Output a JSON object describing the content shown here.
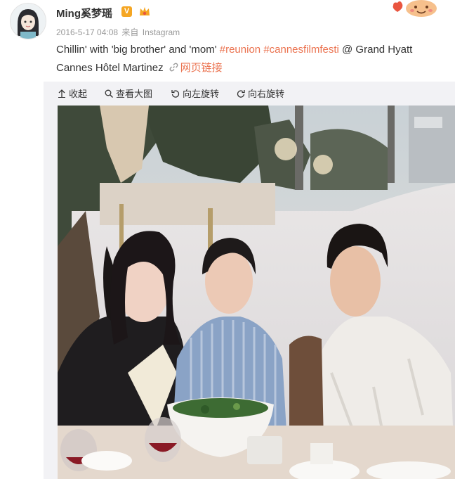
{
  "post": {
    "username": "Ming奚梦瑶",
    "verified_badge": "V",
    "time": "2016-5-17 04:08",
    "source_prefix": "来自",
    "source": "Instagram",
    "text_plain_1": "Chillin' with 'big brother' and 'mom' ",
    "tag_1": "#reunion",
    "text_plain_2": " ",
    "tag_2": "#cannesfilmfesti",
    "text_plain_3": " @ Grand Hyatt Cannes Hôtel Martinez",
    "web_link": "网页链接"
  },
  "toolbar": {
    "collapse": "收起",
    "view_large": "查看大图",
    "rotate_left": "向左旋转",
    "rotate_right": "向右旋转"
  },
  "icons": {
    "collapse": "arrow-up-icon",
    "view_large": "magnifier-icon",
    "rotate_left": "rotate-left-icon",
    "rotate_right": "rotate-right-icon",
    "web_link": "link-icon"
  },
  "colors": {
    "accent": "#eb7350",
    "verified": "#f5a623",
    "meta_text": "#999999",
    "media_bg": "#f2f2f5"
  }
}
